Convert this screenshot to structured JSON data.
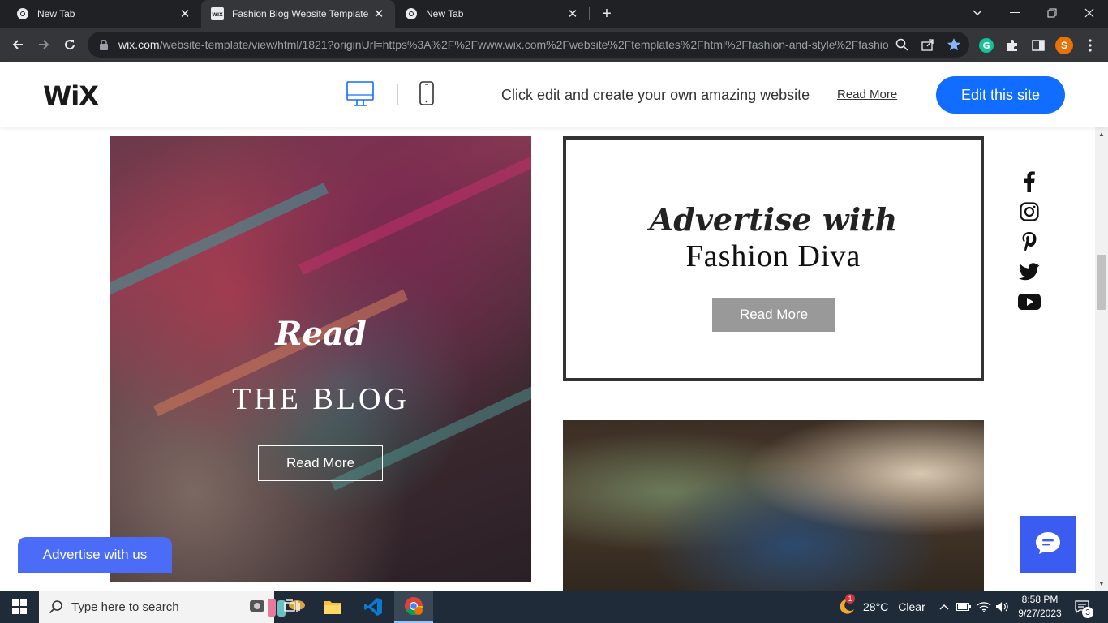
{
  "browser": {
    "tabs": [
      {
        "title": "New Tab",
        "icon": "chrome-icon"
      },
      {
        "title": "Fashion Blog Website Template |",
        "icon": "wix-favicon-icon"
      },
      {
        "title": "New Tab",
        "icon": "chrome-icon"
      }
    ],
    "url_host": "wix.com",
    "url_path": "/website-template/view/html/1821?originUrl=https%3A%2F%2Fwww.wix.com%2Fwebsite%2Ftemplates%2Fhtml%2Ffashion-and-style%2Ffashio...",
    "profile_initial": "S"
  },
  "wixbar": {
    "logo": "WiX",
    "promo": "Click edit and create your own amazing website",
    "read_more": "Read More",
    "edit_button": "Edit this site"
  },
  "site": {
    "blog_card": {
      "script": "Read",
      "title": "THE BLOG",
      "button": "Read More"
    },
    "ad_card": {
      "script": "Advertise with",
      "title": "Fashion Diva",
      "button": "Read More"
    },
    "advertise_tab": "Advertise with us",
    "social": [
      "facebook-icon",
      "instagram-icon",
      "pinterest-icon",
      "twitter-icon",
      "youtube-icon"
    ]
  },
  "taskbar": {
    "search_placeholder": "Type here to search",
    "weather": {
      "temp": "28°C",
      "condition": "Clear",
      "badge": "1"
    },
    "time": "8:58 PM",
    "date": "9/27/2023",
    "notification_count": "3"
  },
  "colors": {
    "wix_blue": "#116dff",
    "advertise_blue": "#4a6cf7",
    "chat_blue": "#3a5cf0",
    "chrome_dark": "#202124",
    "taskbar": "#1f2b38"
  }
}
